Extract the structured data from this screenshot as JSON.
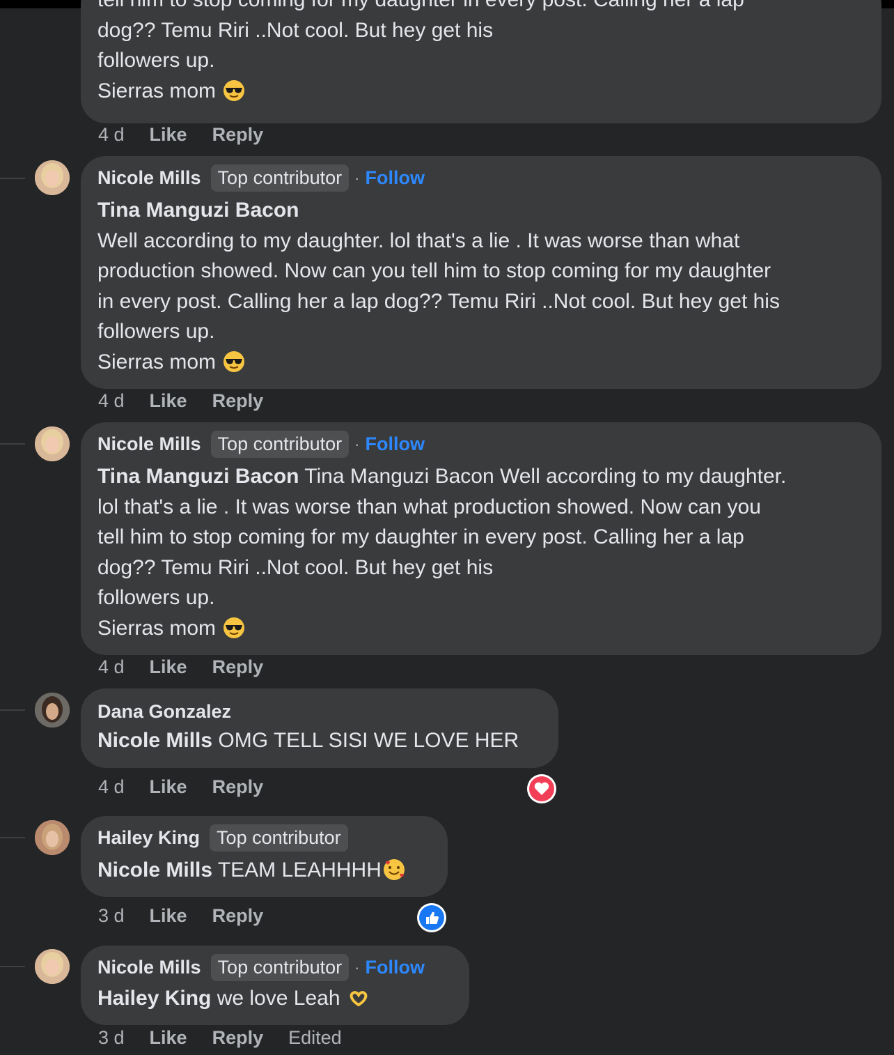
{
  "colors": {
    "background": "#242526",
    "bubble": "#3a3b3c",
    "follow_link": "#2d88ff",
    "love_reaction": "#f33e58",
    "like_reaction": "#1877f2"
  },
  "comments": [
    {
      "partial": true,
      "lines": [
        "tell him to stop coming for my daughter in every post. Calling her a lap",
        "dog?? Temu Riri ..Not cool. But hey get his",
        "followers up.",
        "Sierras mom"
      ],
      "emoji": "smiling-face-with-sunglasses",
      "time": "4 d",
      "like": "Like",
      "reply": "Reply"
    },
    {
      "author": "Nicole Mills",
      "badge": "Top contributor",
      "separator": "·",
      "follow": "Follow",
      "tag": "Tina Manguzi Bacon",
      "lines": [
        "Well according to my daughter. lol that's a lie . It was worse than what",
        "production showed. Now can you tell him to stop coming for my daughter",
        "in every post. Calling her a lap dog?? Temu Riri ..Not cool. But hey get his",
        "followers up.",
        "Sierras mom"
      ],
      "emoji": "smiling-face-with-sunglasses",
      "time": "4 d",
      "like": "Like",
      "reply": "Reply"
    },
    {
      "author": "Nicole Mills",
      "badge": "Top contributor",
      "separator": "·",
      "follow": "Follow",
      "tag": "Tina Manguzi Bacon",
      "first_line_rest": " Tina Manguzi Bacon Well according to my daughter.",
      "lines": [
        "lol that's a lie . It was worse than what production showed. Now can you",
        "tell him to stop coming for my daughter in every post. Calling her a lap",
        "dog?? Temu Riri ..Not cool. But hey get his",
        "followers up.",
        "Sierras mom"
      ],
      "emoji": "smiling-face-with-sunglasses",
      "time": "4 d",
      "like": "Like",
      "reply": "Reply"
    },
    {
      "author": "Dana Gonzalez",
      "tag": "Nicole Mills",
      "text": " OMG TELL SISI WE LOVE HER",
      "time": "4 d",
      "like": "Like",
      "reply": "Reply",
      "reaction": "love-reaction-icon"
    },
    {
      "author": "Hailey King",
      "badge": "Top contributor",
      "tag": "Nicole Mills",
      "text": " TEAM LEAHHHH",
      "emoji": "smiling-face-with-hearts",
      "time": "3 d",
      "like": "Like",
      "reply": "Reply",
      "reaction": "like-reaction-icon"
    },
    {
      "author": "Nicole Mills",
      "badge": "Top contributor",
      "separator": "·",
      "follow": "Follow",
      "tag": "Hailey King",
      "text": " we love Leah",
      "emoji": "heart-hands",
      "time": "3 d",
      "like": "Like",
      "reply": "Reply",
      "edited": "Edited"
    }
  ]
}
